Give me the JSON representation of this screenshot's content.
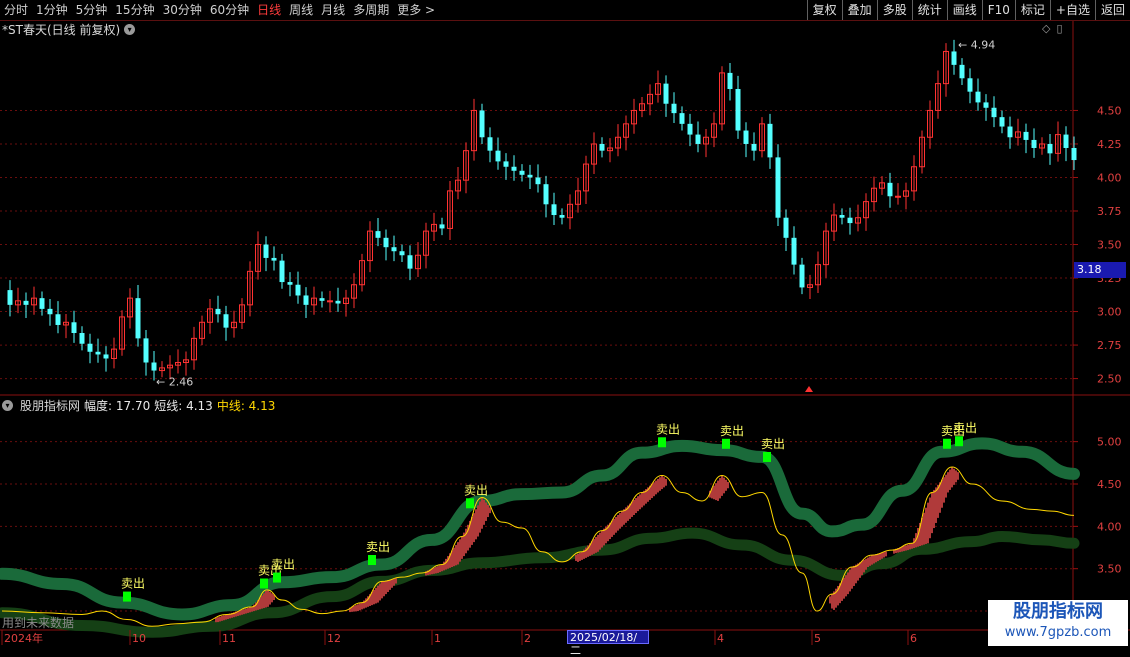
{
  "toolbar": {
    "periods": [
      "分时",
      "1分钟",
      "5分钟",
      "15分钟",
      "30分钟",
      "60分钟",
      "日线",
      "周线",
      "月线",
      "多周期",
      "更多 >"
    ],
    "active_period": "日线",
    "right_buttons": [
      "复权",
      "叠加",
      "多股",
      "统计",
      "画线",
      "F10",
      "标记",
      "+自选",
      "返回"
    ]
  },
  "main_chart": {
    "title": "*ST春天(日线 前复权)",
    "high_label": "4.94",
    "low_label": "2.46",
    "current_price": "3.18",
    "y_ticks": [
      "4.50",
      "4.25",
      "4.00",
      "3.75",
      "3.50",
      "3.25",
      "3.00",
      "2.75",
      "2.50"
    ]
  },
  "indicator": {
    "name": "股朋指标网",
    "amplitude_label": "幅度: 17.70",
    "short_label": "短线: 4.13",
    "mid_label": "中线: 4.13",
    "y_ticks": [
      "5.00",
      "4.50",
      "4.00",
      "3.50",
      "3.00"
    ],
    "sell_label": "卖出",
    "future_data_note": "用到未来数据"
  },
  "x_axis": {
    "labels": [
      "2024年",
      "10",
      "11",
      "12",
      "1",
      "2",
      "4",
      "5",
      "6"
    ],
    "selected_date": "2025/02/18/二"
  },
  "watermark": {
    "title": "股朋指标网",
    "url": "www.7gpzb.com"
  },
  "colors": {
    "up": "#ff3232",
    "down": "#54ffff",
    "band_upper": "#1a6a3a",
    "band_lower": "#154015",
    "short_line": "#ffd700",
    "grid": "#6a0e0e",
    "sell_signal": "#00ff00"
  },
  "chart_data": {
    "type": "candlestick",
    "price_range": [
      2.4,
      5.1
    ],
    "close_path": [
      [
        0,
        3.16
      ],
      [
        8,
        3.05
      ],
      [
        16,
        3.08
      ],
      [
        24,
        3.05
      ],
      [
        32,
        3.1
      ],
      [
        40,
        3.02
      ],
      [
        48,
        2.98
      ],
      [
        56,
        2.9
      ],
      [
        64,
        2.92
      ],
      [
        72,
        2.84
      ],
      [
        80,
        2.76
      ],
      [
        88,
        2.7
      ],
      [
        96,
        2.68
      ],
      [
        104,
        2.65
      ],
      [
        112,
        2.72
      ],
      [
        120,
        2.96
      ],
      [
        128,
        3.1
      ],
      [
        136,
        2.8
      ],
      [
        144,
        2.62
      ],
      [
        152,
        2.56
      ],
      [
        160,
        2.58
      ],
      [
        168,
        2.6
      ],
      [
        176,
        2.62
      ],
      [
        184,
        2.64
      ],
      [
        192,
        2.8
      ],
      [
        200,
        2.92
      ],
      [
        208,
        3.02
      ],
      [
        216,
        2.98
      ],
      [
        224,
        2.88
      ],
      [
        232,
        2.92
      ],
      [
        240,
        3.05
      ],
      [
        248,
        3.3
      ],
      [
        256,
        3.5
      ],
      [
        264,
        3.4
      ],
      [
        272,
        3.38
      ],
      [
        280,
        3.22
      ],
      [
        288,
        3.2
      ],
      [
        296,
        3.12
      ],
      [
        304,
        3.05
      ],
      [
        312,
        3.1
      ],
      [
        320,
        3.08
      ],
      [
        328,
        3.08
      ],
      [
        336,
        3.06
      ],
      [
        344,
        3.1
      ],
      [
        352,
        3.2
      ],
      [
        360,
        3.38
      ],
      [
        368,
        3.6
      ],
      [
        376,
        3.55
      ],
      [
        384,
        3.48
      ],
      [
        392,
        3.45
      ],
      [
        400,
        3.42
      ],
      [
        408,
        3.32
      ],
      [
        416,
        3.42
      ],
      [
        424,
        3.6
      ],
      [
        432,
        3.65
      ],
      [
        440,
        3.62
      ],
      [
        448,
        3.9
      ],
      [
        456,
        3.98
      ],
      [
        464,
        4.2
      ],
      [
        472,
        4.5
      ],
      [
        480,
        4.3
      ],
      [
        488,
        4.2
      ],
      [
        496,
        4.12
      ],
      [
        504,
        4.08
      ],
      [
        512,
        4.05
      ],
      [
        520,
        4.02
      ],
      [
        528,
        4.0
      ],
      [
        536,
        3.95
      ],
      [
        544,
        3.8
      ],
      [
        552,
        3.72
      ],
      [
        560,
        3.7
      ],
      [
        568,
        3.8
      ],
      [
        576,
        3.9
      ],
      [
        584,
        4.1
      ],
      [
        592,
        4.25
      ],
      [
        600,
        4.2
      ],
      [
        608,
        4.22
      ],
      [
        616,
        4.3
      ],
      [
        624,
        4.4
      ],
      [
        632,
        4.5
      ],
      [
        640,
        4.55
      ],
      [
        648,
        4.62
      ],
      [
        656,
        4.7
      ],
      [
        664,
        4.55
      ],
      [
        672,
        4.48
      ],
      [
        680,
        4.4
      ],
      [
        688,
        4.32
      ],
      [
        696,
        4.25
      ],
      [
        704,
        4.3
      ],
      [
        712,
        4.4
      ],
      [
        720,
        4.78
      ],
      [
        728,
        4.66
      ],
      [
        736,
        4.35
      ],
      [
        744,
        4.25
      ],
      [
        752,
        4.2
      ],
      [
        760,
        4.4
      ],
      [
        768,
        4.15
      ],
      [
        776,
        3.7
      ],
      [
        784,
        3.55
      ],
      [
        792,
        3.35
      ],
      [
        800,
        3.18
      ],
      [
        808,
        3.2
      ],
      [
        816,
        3.35
      ],
      [
        824,
        3.6
      ],
      [
        832,
        3.72
      ],
      [
        840,
        3.7
      ],
      [
        848,
        3.66
      ],
      [
        856,
        3.7
      ],
      [
        864,
        3.82
      ],
      [
        872,
        3.92
      ],
      [
        880,
        3.96
      ],
      [
        888,
        3.86
      ],
      [
        896,
        3.86
      ],
      [
        904,
        3.9
      ],
      [
        912,
        4.08
      ],
      [
        920,
        4.3
      ],
      [
        928,
        4.5
      ],
      [
        936,
        4.7
      ],
      [
        944,
        4.94
      ],
      [
        952,
        4.84
      ],
      [
        960,
        4.74
      ],
      [
        968,
        4.64
      ],
      [
        976,
        4.56
      ],
      [
        984,
        4.52
      ],
      [
        992,
        4.45
      ],
      [
        1000,
        4.38
      ],
      [
        1008,
        4.3
      ],
      [
        1016,
        4.34
      ],
      [
        1024,
        4.28
      ],
      [
        1032,
        4.22
      ],
      [
        1040,
        4.25
      ],
      [
        1048,
        4.18
      ],
      [
        1056,
        4.32
      ],
      [
        1064,
        4.22
      ],
      [
        1072,
        4.13
      ]
    ],
    "indicator_range": [
      2.8,
      5.35
    ],
    "upper_band": [
      [
        0,
        3.44
      ],
      [
        60,
        3.32
      ],
      [
        120,
        3.1
      ],
      [
        180,
        2.96
      ],
      [
        230,
        3.07
      ],
      [
        280,
        3.34
      ],
      [
        330,
        3.4
      ],
      [
        380,
        3.55
      ],
      [
        430,
        3.84
      ],
      [
        480,
        4.3
      ],
      [
        520,
        4.38
      ],
      [
        560,
        4.4
      ],
      [
        600,
        4.6
      ],
      [
        640,
        4.87
      ],
      [
        680,
        4.95
      ],
      [
        720,
        4.9
      ],
      [
        760,
        4.82
      ],
      [
        800,
        4.15
      ],
      [
        830,
        3.94
      ],
      [
        860,
        4.02
      ],
      [
        900,
        4.42
      ],
      [
        940,
        4.88
      ],
      [
        980,
        4.98
      ],
      [
        1020,
        4.88
      ],
      [
        1072,
        4.62
      ]
    ],
    "lower_band": [
      [
        0,
        2.98
      ],
      [
        80,
        2.83
      ],
      [
        150,
        2.75
      ],
      [
        210,
        2.82
      ],
      [
        270,
        2.98
      ],
      [
        330,
        3.17
      ],
      [
        380,
        3.35
      ],
      [
        430,
        3.48
      ],
      [
        480,
        3.57
      ],
      [
        540,
        3.63
      ],
      [
        600,
        3.72
      ],
      [
        650,
        3.86
      ],
      [
        690,
        3.92
      ],
      [
        740,
        3.78
      ],
      [
        790,
        3.6
      ],
      [
        840,
        3.42
      ],
      [
        880,
        3.56
      ],
      [
        920,
        3.73
      ],
      [
        970,
        3.82
      ],
      [
        1000,
        3.88
      ],
      [
        1040,
        3.84
      ],
      [
        1072,
        3.8
      ]
    ],
    "short_line": [
      [
        0,
        3.0
      ],
      [
        40,
        2.98
      ],
      [
        80,
        2.96
      ],
      [
        100,
        3.0
      ],
      [
        125,
        2.9
      ],
      [
        150,
        2.82
      ],
      [
        175,
        2.85
      ],
      [
        200,
        2.87
      ],
      [
        225,
        2.96
      ],
      [
        250,
        3.05
      ],
      [
        265,
        3.25
      ],
      [
        280,
        3.13
      ],
      [
        300,
        3.02
      ],
      [
        320,
        2.97
      ],
      [
        340,
        3.0
      ],
      [
        360,
        3.1
      ],
      [
        380,
        3.35
      ],
      [
        400,
        3.4
      ],
      [
        420,
        3.45
      ],
      [
        440,
        3.55
      ],
      [
        460,
        3.88
      ],
      [
        480,
        4.34
      ],
      [
        500,
        4.05
      ],
      [
        520,
        3.98
      ],
      [
        540,
        3.7
      ],
      [
        560,
        3.58
      ],
      [
        580,
        3.7
      ],
      [
        600,
        3.95
      ],
      [
        620,
        4.18
      ],
      [
        640,
        4.4
      ],
      [
        660,
        4.6
      ],
      [
        680,
        4.4
      ],
      [
        700,
        4.3
      ],
      [
        720,
        4.6
      ],
      [
        740,
        4.35
      ],
      [
        760,
        4.4
      ],
      [
        780,
        3.9
      ],
      [
        800,
        3.45
      ],
      [
        815,
        3.0
      ],
      [
        830,
        3.2
      ],
      [
        850,
        3.52
      ],
      [
        870,
        3.66
      ],
      [
        890,
        3.72
      ],
      [
        910,
        3.8
      ],
      [
        930,
        4.4
      ],
      [
        950,
        4.7
      ],
      [
        970,
        4.5
      ],
      [
        1000,
        4.3
      ],
      [
        1030,
        4.2
      ],
      [
        1050,
        4.18
      ],
      [
        1072,
        4.13
      ]
    ],
    "sell_signals": [
      125,
      262,
      275,
      370,
      468,
      660,
      724,
      765,
      945,
      957
    ]
  }
}
